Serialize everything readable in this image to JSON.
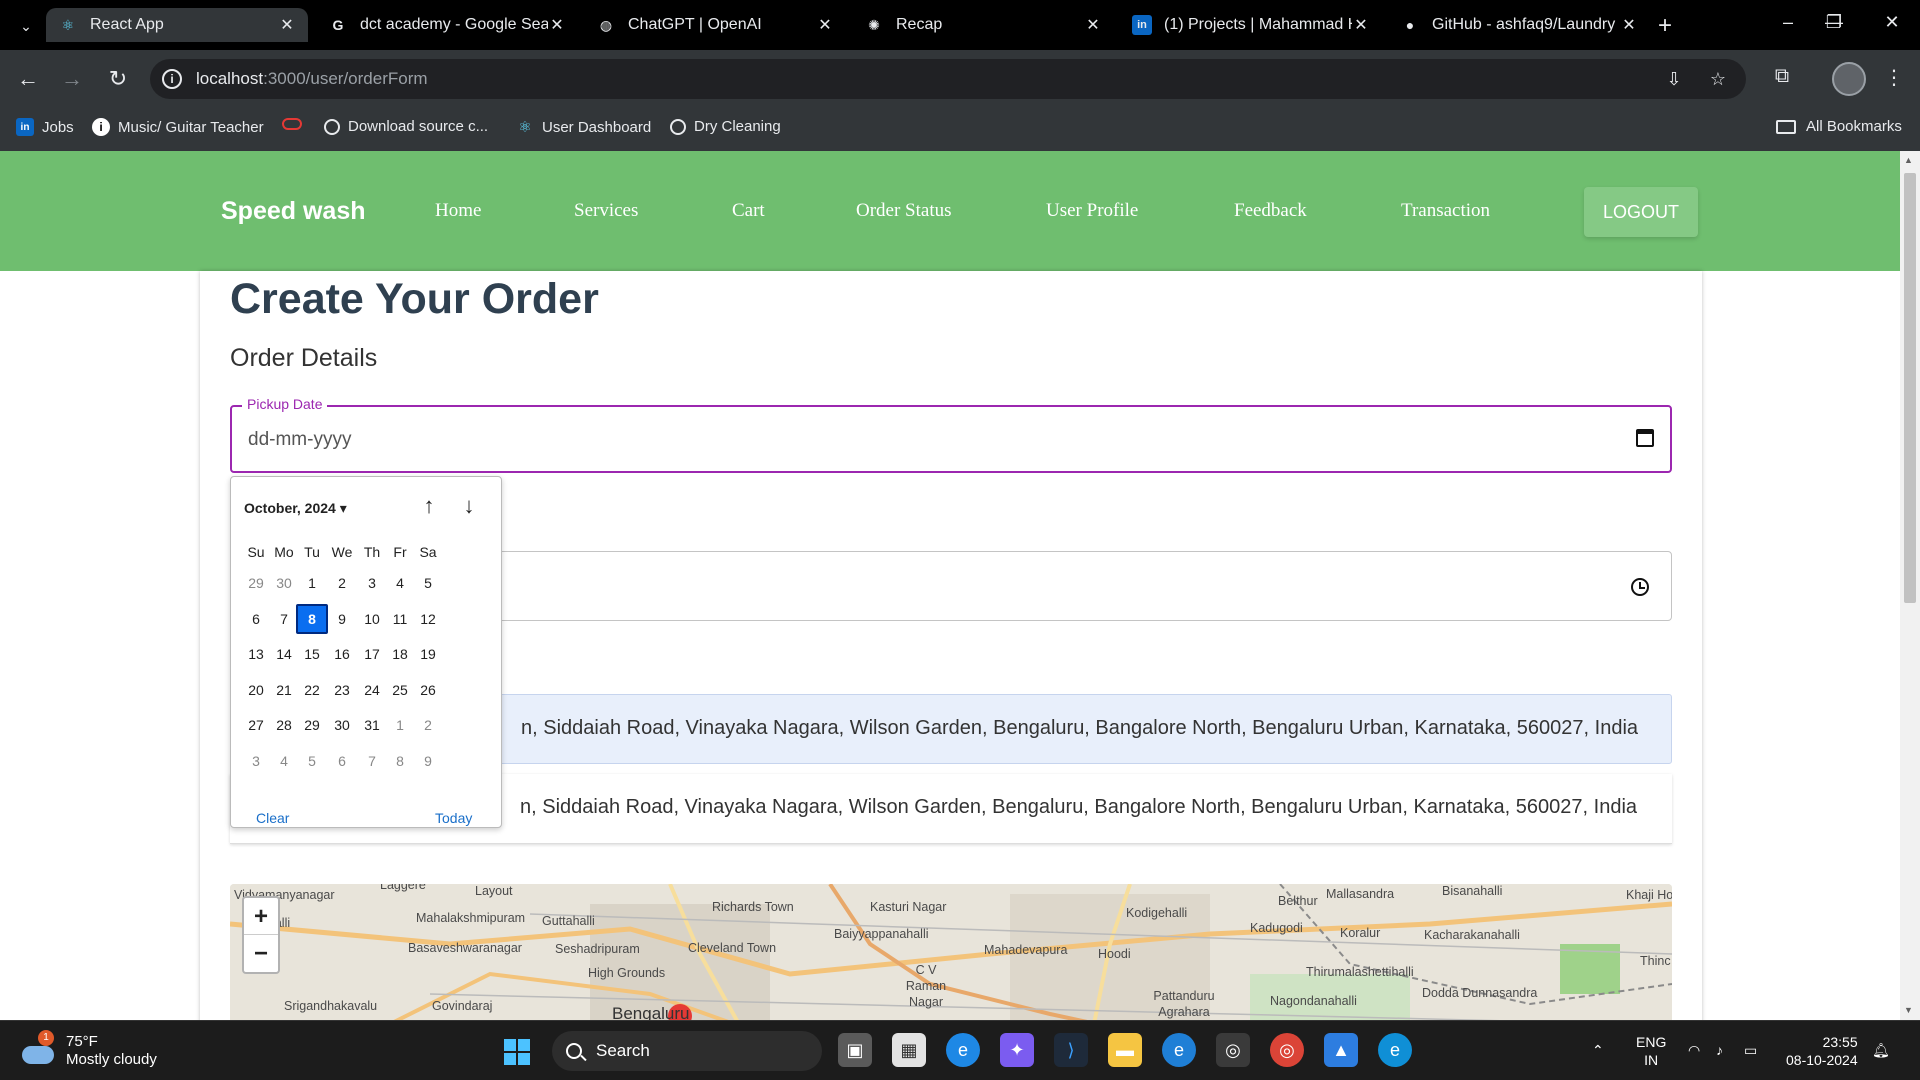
{
  "browser": {
    "tabs": [
      {
        "title": "React App",
        "icon": "react-icon",
        "active": true
      },
      {
        "title": "dct academy - Google Sear",
        "icon": "google-icon",
        "active": false
      },
      {
        "title": "ChatGPT | OpenAI",
        "icon": "globe-icon",
        "active": false
      },
      {
        "title": "Recap",
        "icon": "openai-icon",
        "active": false
      },
      {
        "title": "(1) Projects | Mahammad H",
        "icon": "linkedin-icon",
        "active": false
      },
      {
        "title": "GitHub - ashfaq9/Laundry",
        "icon": "github-icon",
        "active": false
      }
    ],
    "url_host": "localhost",
    "url_path": ":3000/user/orderForm",
    "bookmarks": [
      {
        "label": "Jobs",
        "icon": "linkedin-icon"
      },
      {
        "label": "Music/ Guitar Teacher",
        "icon": "info-icon"
      },
      {
        "label": "",
        "icon": "red-ring-icon"
      },
      {
        "label": "Download source c...",
        "icon": "globe-icon"
      },
      {
        "label": "User Dashboard",
        "icon": "react-icon"
      },
      {
        "label": "Dry Cleaning",
        "icon": "globe-icon"
      }
    ],
    "all_bookmarks": "All Bookmarks"
  },
  "app": {
    "brand": "Speed wash",
    "nav": [
      "Home",
      "Services",
      "Cart",
      "Order Status",
      "User Profile",
      "Feedback",
      "Transaction"
    ],
    "logout": "LOGOUT",
    "accent": "#6fbe6f"
  },
  "form": {
    "title": "Create Your Order",
    "section": "Order Details",
    "pickup_label": "Pickup Date",
    "pickup_placeholder": "dd-mm-yyyy",
    "address_selected": "n, Siddaiah Road, Vinayaka Nagara, Wilson Garden, Bengaluru, Bangalore North, Bengaluru Urban, Karnataka, 560027, India",
    "address_option": "n, Siddaiah Road, Vinayaka Nagara, Wilson Garden, Bengaluru, Bangalore North, Bengaluru Urban, Karnataka, 560027, India"
  },
  "datepicker": {
    "month_label": "October, 2024",
    "weekdays": [
      "Su",
      "Mo",
      "Tu",
      "We",
      "Th",
      "Fr",
      "Sa"
    ],
    "weeks": [
      [
        "29",
        "30",
        "1",
        "2",
        "3",
        "4",
        "5"
      ],
      [
        "6",
        "7",
        "8",
        "9",
        "10",
        "11",
        "12"
      ],
      [
        "13",
        "14",
        "15",
        "16",
        "17",
        "18",
        "19"
      ],
      [
        "20",
        "21",
        "22",
        "23",
        "24",
        "25",
        "26"
      ],
      [
        "27",
        "28",
        "29",
        "30",
        "31",
        "1",
        "2"
      ],
      [
        "3",
        "4",
        "5",
        "6",
        "7",
        "8",
        "9"
      ]
    ],
    "selected_day": "8",
    "clear": "Clear",
    "today": "Today"
  },
  "map": {
    "zoom_in": "+",
    "zoom_out": "−",
    "labels": [
      "Vidyamanyanagar",
      "hahalli",
      "Mahalakshmipuram",
      "Guttahalli",
      "Basaveshwaranagar",
      "Seshadripuram",
      "Richards Town",
      "Kasturi Nagar",
      "Baiyyappanahalli",
      "Cleveland Town",
      "High Grounds",
      "Mahadevapura",
      "Hoodi",
      "C V Raman Nagar",
      "Srigandhakavalu",
      "Govindaraj",
      "Bengaluru",
      "Kodigehalli",
      "Belthur",
      "Kadugodi",
      "Mallasandra",
      "Bisanahalli",
      "Khaji Ho",
      "Koralur",
      "Kacharakanahalli",
      "Thirumalashettihalli",
      "Pattanduru Agrahara",
      "Dodda Dunnasandra",
      "Nagondanahalli",
      "Layout",
      "Laggere",
      "Thinc"
    ]
  },
  "taskbar": {
    "temp": "75°F",
    "weather": "Mostly cloudy",
    "weather_badge": "1",
    "search": "Search",
    "lang1": "ENG",
    "lang2": "IN",
    "time": "23:55",
    "date": "08-10-2024"
  }
}
